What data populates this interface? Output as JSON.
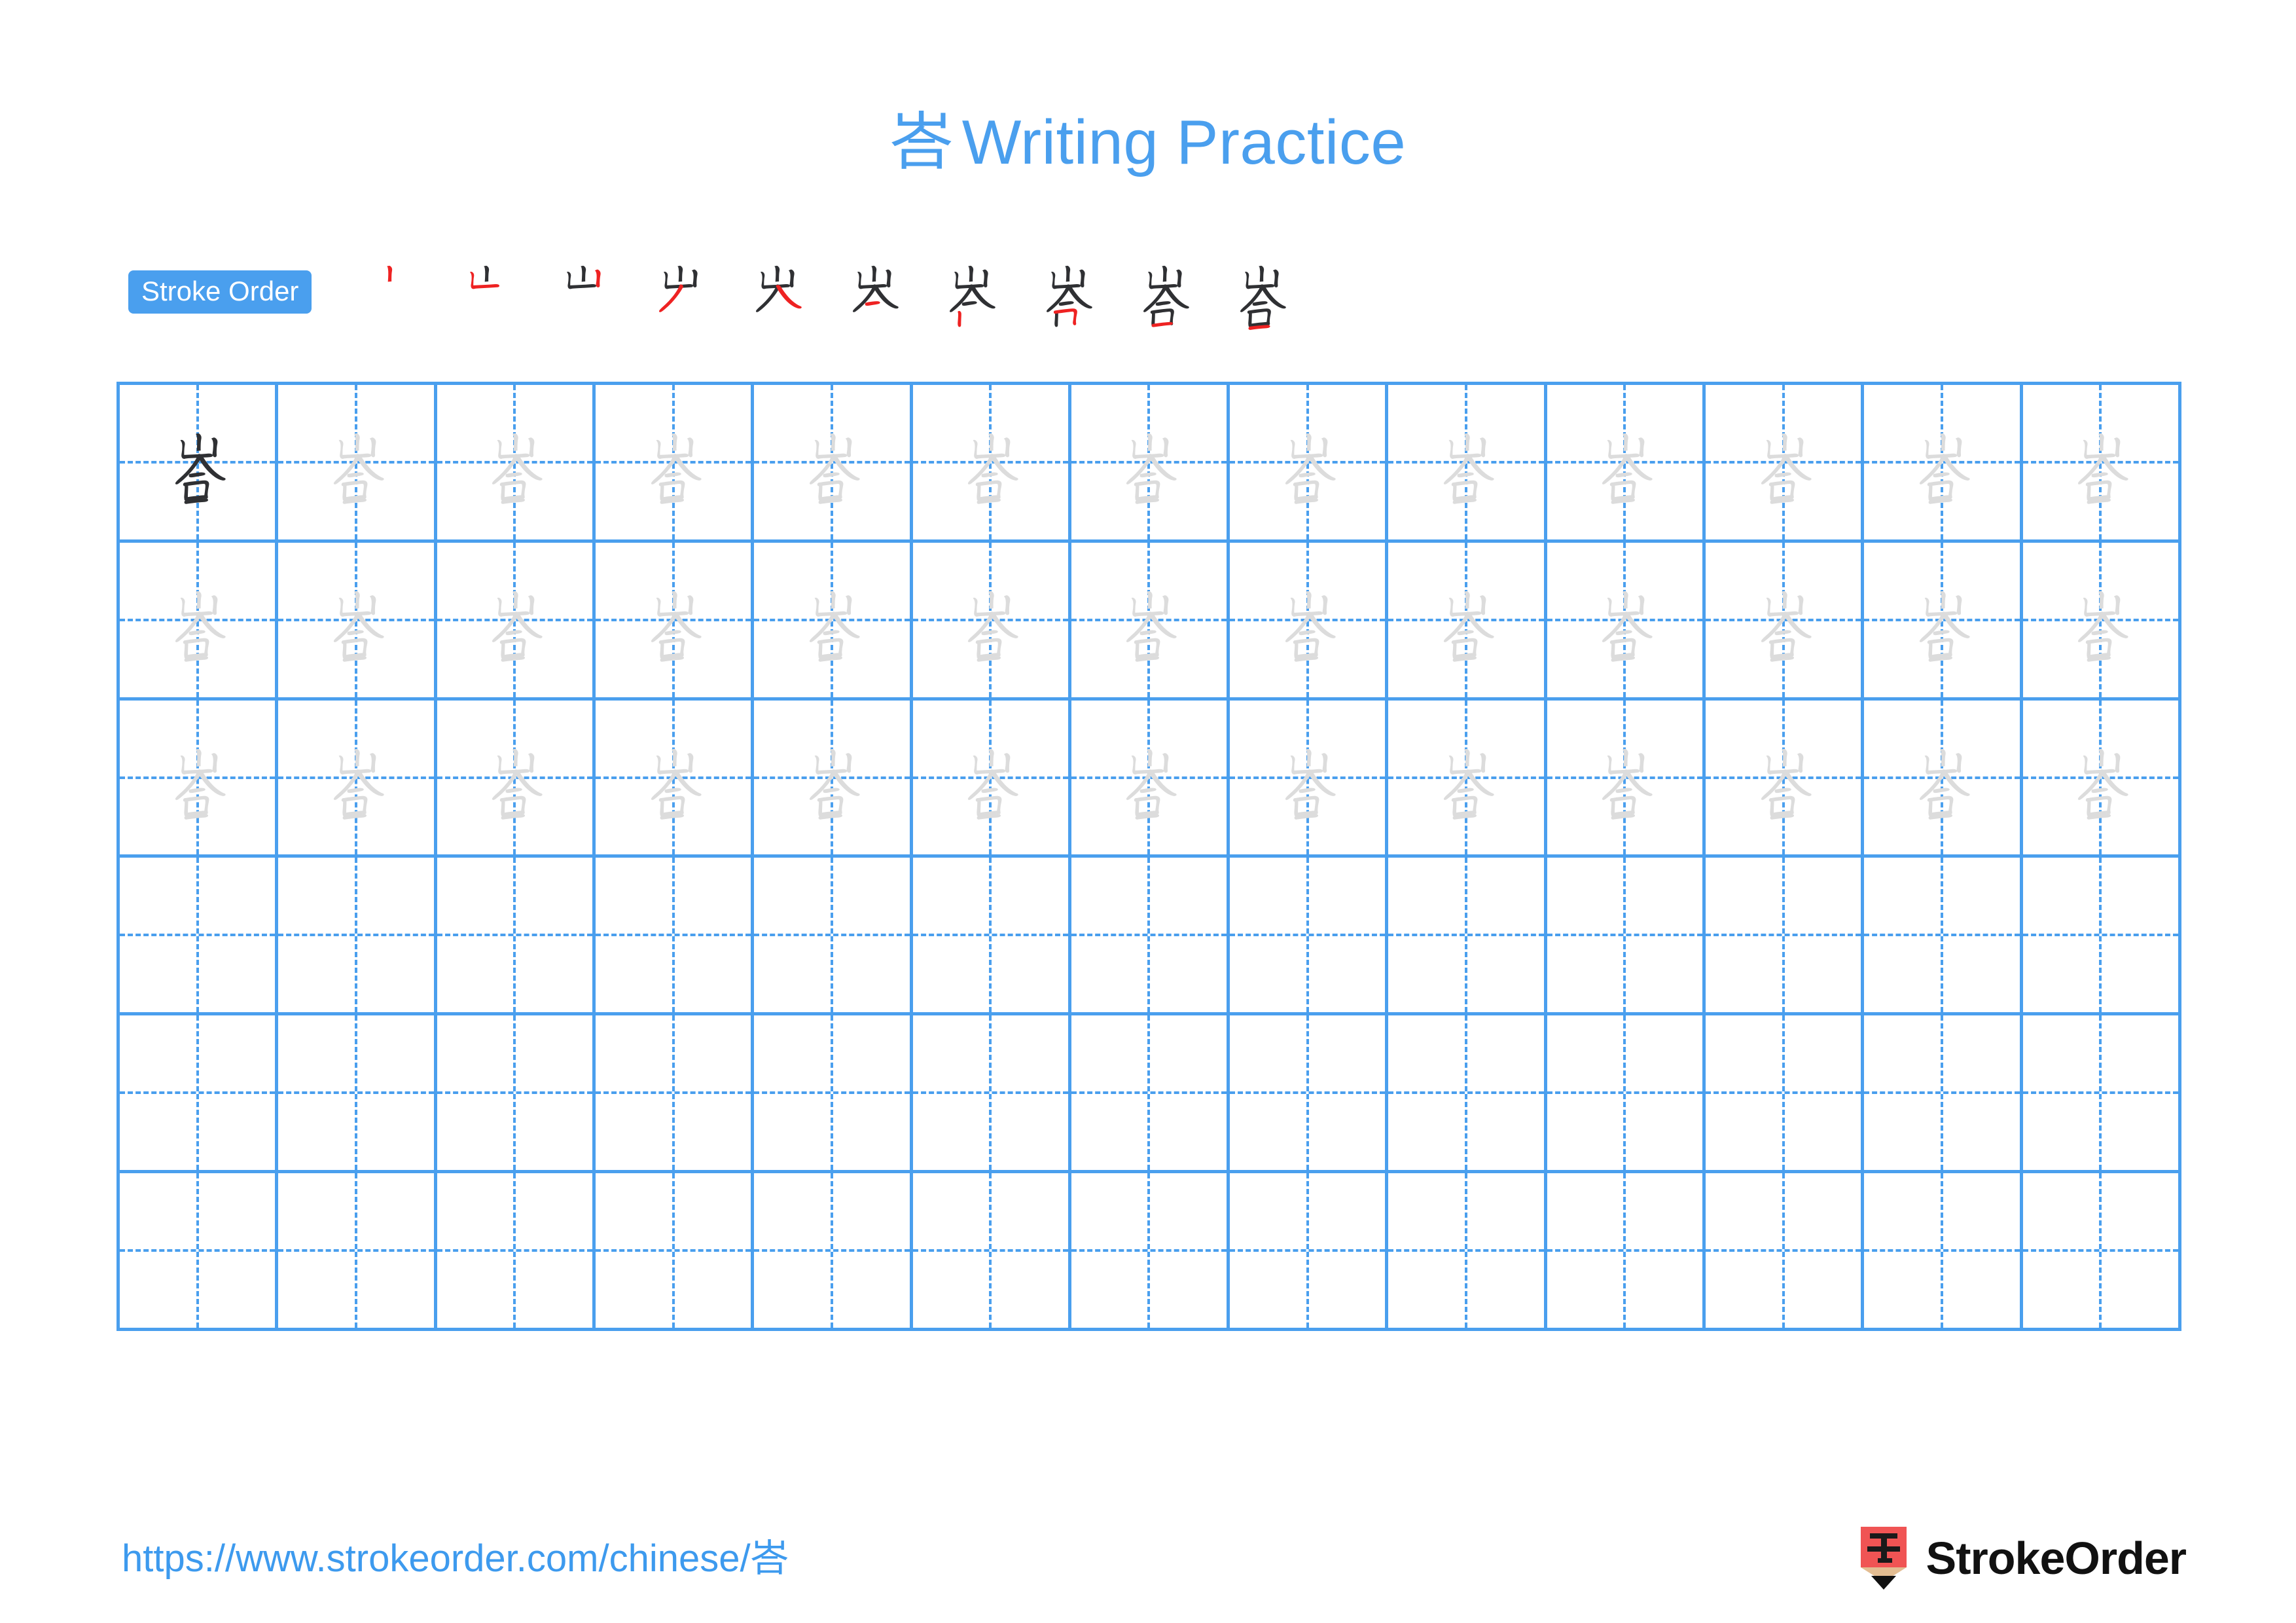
{
  "page": {
    "character": "峇",
    "title_suffix": "Writing Practice",
    "accent_color": "#4a9fee",
    "trace_color": "#dcdcdc",
    "model_color": "#2f3033",
    "highlight_color": "#ee2222"
  },
  "stroke_order": {
    "badge_label": "Stroke Order",
    "total_strokes": 10,
    "steps": [
      {
        "index": 1,
        "new_stroke": "竖 (vertical)"
      },
      {
        "index": 2,
        "new_stroke": "竖折 (vertical-turn)"
      },
      {
        "index": 3,
        "new_stroke": "竖 (vertical)"
      },
      {
        "index": 4,
        "new_stroke": "撇 (left-falling)"
      },
      {
        "index": 5,
        "new_stroke": "捺 (right-falling)"
      },
      {
        "index": 6,
        "new_stroke": "横 (horizontal)"
      },
      {
        "index": 7,
        "new_stroke": "竖 (vertical)"
      },
      {
        "index": 8,
        "new_stroke": "横折 (horizontal-turn)"
      },
      {
        "index": 9,
        "new_stroke": "横 (horizontal)"
      },
      {
        "index": 10,
        "new_stroke": "横 (horizontal)"
      }
    ]
  },
  "grid": {
    "columns": 13,
    "rows": 6,
    "model_cell": {
      "row": 1,
      "col": 1
    },
    "trace_rows": [
      1,
      2,
      3
    ],
    "blank_rows": [
      4,
      5,
      6
    ]
  },
  "footer": {
    "url": "https://www.strokeorder.com/chinese/峇",
    "brand_name": "StrokeOrder",
    "logo_glyph": "字",
    "logo_body_color": "#f05454",
    "logo_wood_color": "#e3bd92",
    "logo_tip_color": "#111111"
  }
}
